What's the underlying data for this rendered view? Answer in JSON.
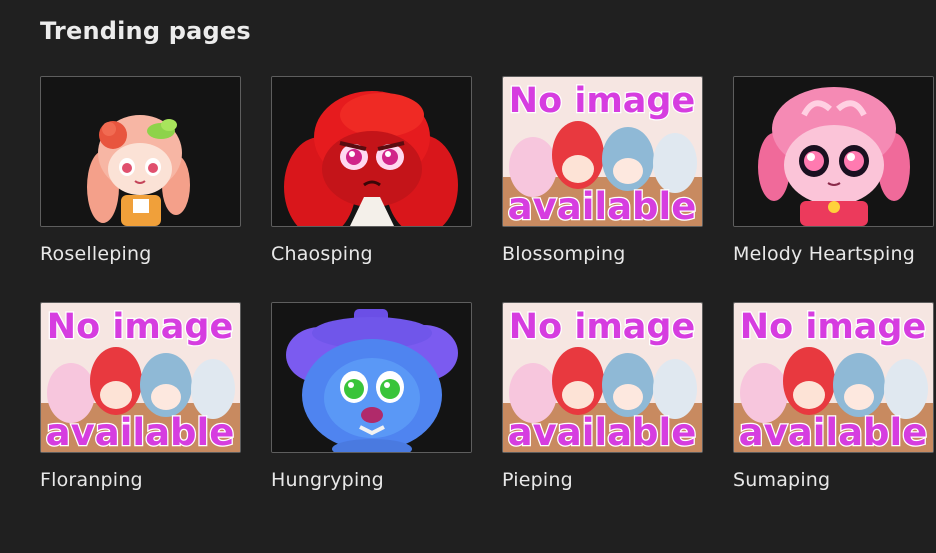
{
  "section": {
    "title": "Trending pages"
  },
  "pages": [
    {
      "name": "Roselleping",
      "thumb": "character-roselleping"
    },
    {
      "name": "Chaosping",
      "thumb": "character-chaosping"
    },
    {
      "name": "Blossomping",
      "thumb": "no-image-available",
      "overlay_lines": [
        "No image",
        "available"
      ]
    },
    {
      "name": "Melody Heartsping",
      "thumb": "character-melody-heartsping"
    },
    {
      "name": "Floranping",
      "thumb": "no-image-available",
      "overlay_lines": [
        "No image",
        "available"
      ]
    },
    {
      "name": "Hungryping",
      "thumb": "character-hungryping"
    },
    {
      "name": "Pieping",
      "thumb": "no-image-available",
      "overlay_lines": [
        "No image",
        "available"
      ]
    },
    {
      "name": "Sumaping",
      "thumb": "no-image-available",
      "overlay_lines": [
        "No image",
        "available"
      ]
    }
  ],
  "colors": {
    "background": "#202020",
    "title_text": "#ececec",
    "label_text": "#e8e8e8",
    "thumb_border": "#5e5e5e",
    "placeholder_text": "#d63de0"
  }
}
